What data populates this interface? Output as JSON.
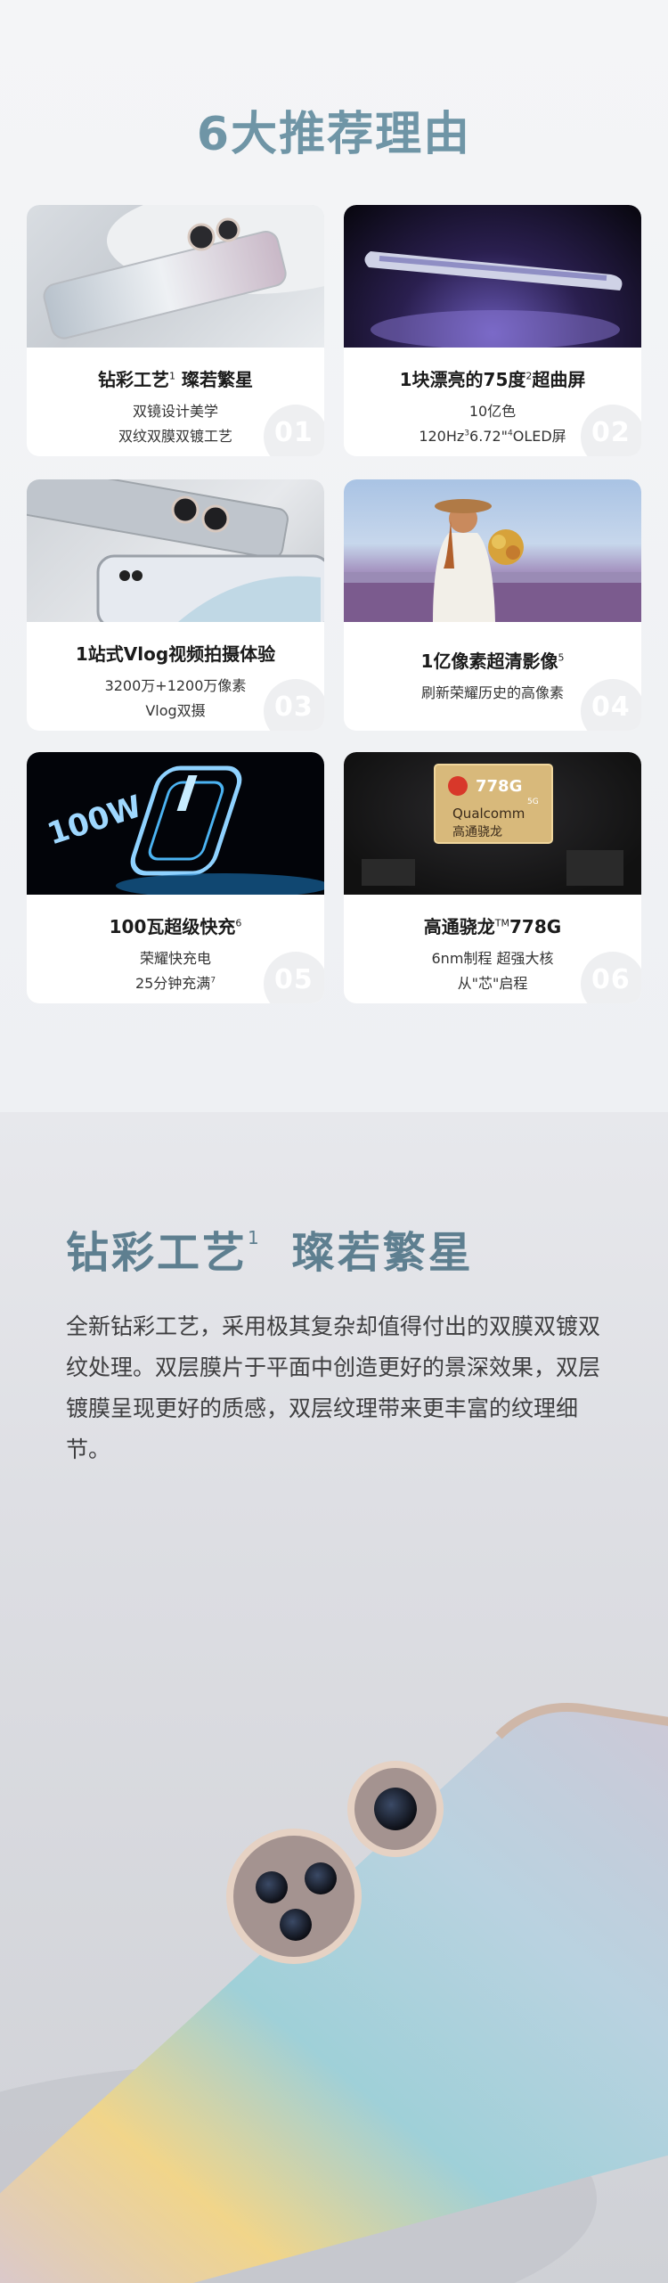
{
  "reasons": {
    "title": "6大推荐理由",
    "cards": [
      {
        "title": "钻彩工艺",
        "title_sup": "1",
        "title_rest": " 璨若繁星",
        "line1": "双镜设计美学",
        "line2": "双纹双膜双镀工艺",
        "num": "01"
      },
      {
        "title": "1块漂亮的75度",
        "title_sup": "2",
        "title_rest": "超曲屏",
        "line1": "10亿色",
        "line2_a": "120Hz",
        "line2_sup1": "3",
        "line2_b": "6.72\"",
        "line2_sup2": "4",
        "line2_c": "OLED屏",
        "num": "02"
      },
      {
        "title": "1站式Vlog视频拍摄体验",
        "line1": "3200万+1200万像素",
        "line2": "Vlog双摄",
        "num": "03"
      },
      {
        "title": "1亿像素超清影像",
        "title_sup": "5",
        "line1": "刷新荣耀历史的高像素",
        "num": "04"
      },
      {
        "title": "100瓦超级快充",
        "title_sup": "6",
        "line1": "荣耀快充电",
        "line2": "25分钟充满",
        "line2_sup": "7",
        "num": "05"
      },
      {
        "title": "高通骁龙",
        "title_sup": "TM",
        "title_rest": "778G",
        "line1": "6nm制程 超强大核",
        "line2": "从\"芯\"启程",
        "num": "06"
      }
    ],
    "charge_text": "100W",
    "chip_text": "778G",
    "chip_sub": "5G",
    "chip_brand": "Qualcomm",
    "chip_name": "高通骁龙"
  },
  "craft": {
    "title_a": "钻彩工艺",
    "title_sup": "1",
    "title_b": "璨若繁星",
    "body": "全新钻彩工艺，采用极其复杂却值得付出的双膜双镀双纹处理。双层膜片于平面中创造更好的景深效果，双层镀膜呈现更好的质感，双层纹理带来更丰富的纹理细节。"
  }
}
